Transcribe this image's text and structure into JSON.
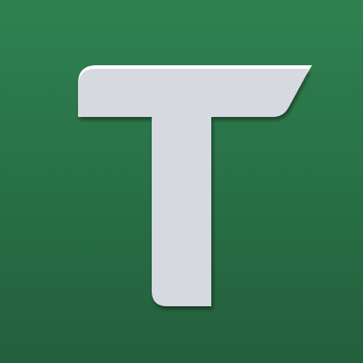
{
  "icon": {
    "name": "T logo app icon",
    "letter": "T",
    "colors": {
      "background_top": "#2e8250",
      "background_bottom": "#235f3c",
      "letter_face": "#d6d9e0",
      "letter_highlight": "#ffffff",
      "letter_shadow": "#1c4a2e"
    }
  }
}
